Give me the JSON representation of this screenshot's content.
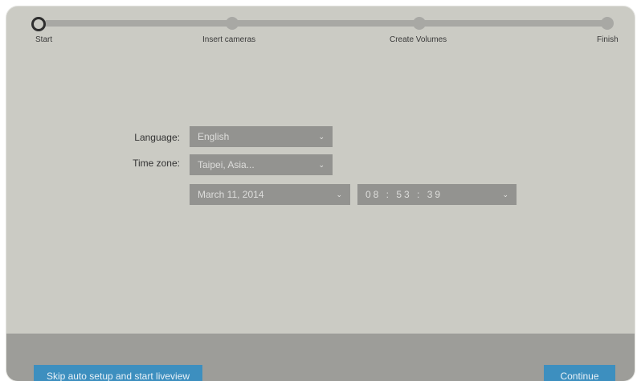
{
  "steps": {
    "start": "Start",
    "insert_cameras": "Insert cameras",
    "create_volumes": "Create Volumes",
    "finish": "Finish"
  },
  "form": {
    "language_label": "Language:",
    "language_value": "English",
    "timezone_label": "Time zone:",
    "timezone_value": "Taipei, Asia...",
    "date_value": "March 11, 2014",
    "time_value": "08 : 53 : 39"
  },
  "footer": {
    "skip_label": "Skip auto setup and start liveview",
    "continue_label": "Continue"
  },
  "colors": {
    "accent": "#3d8fbf",
    "panel": "#cbcbc4",
    "footer": "#9d9d99",
    "select": "#939390"
  },
  "icons": {
    "dropdown": "chevron-down-icon"
  }
}
